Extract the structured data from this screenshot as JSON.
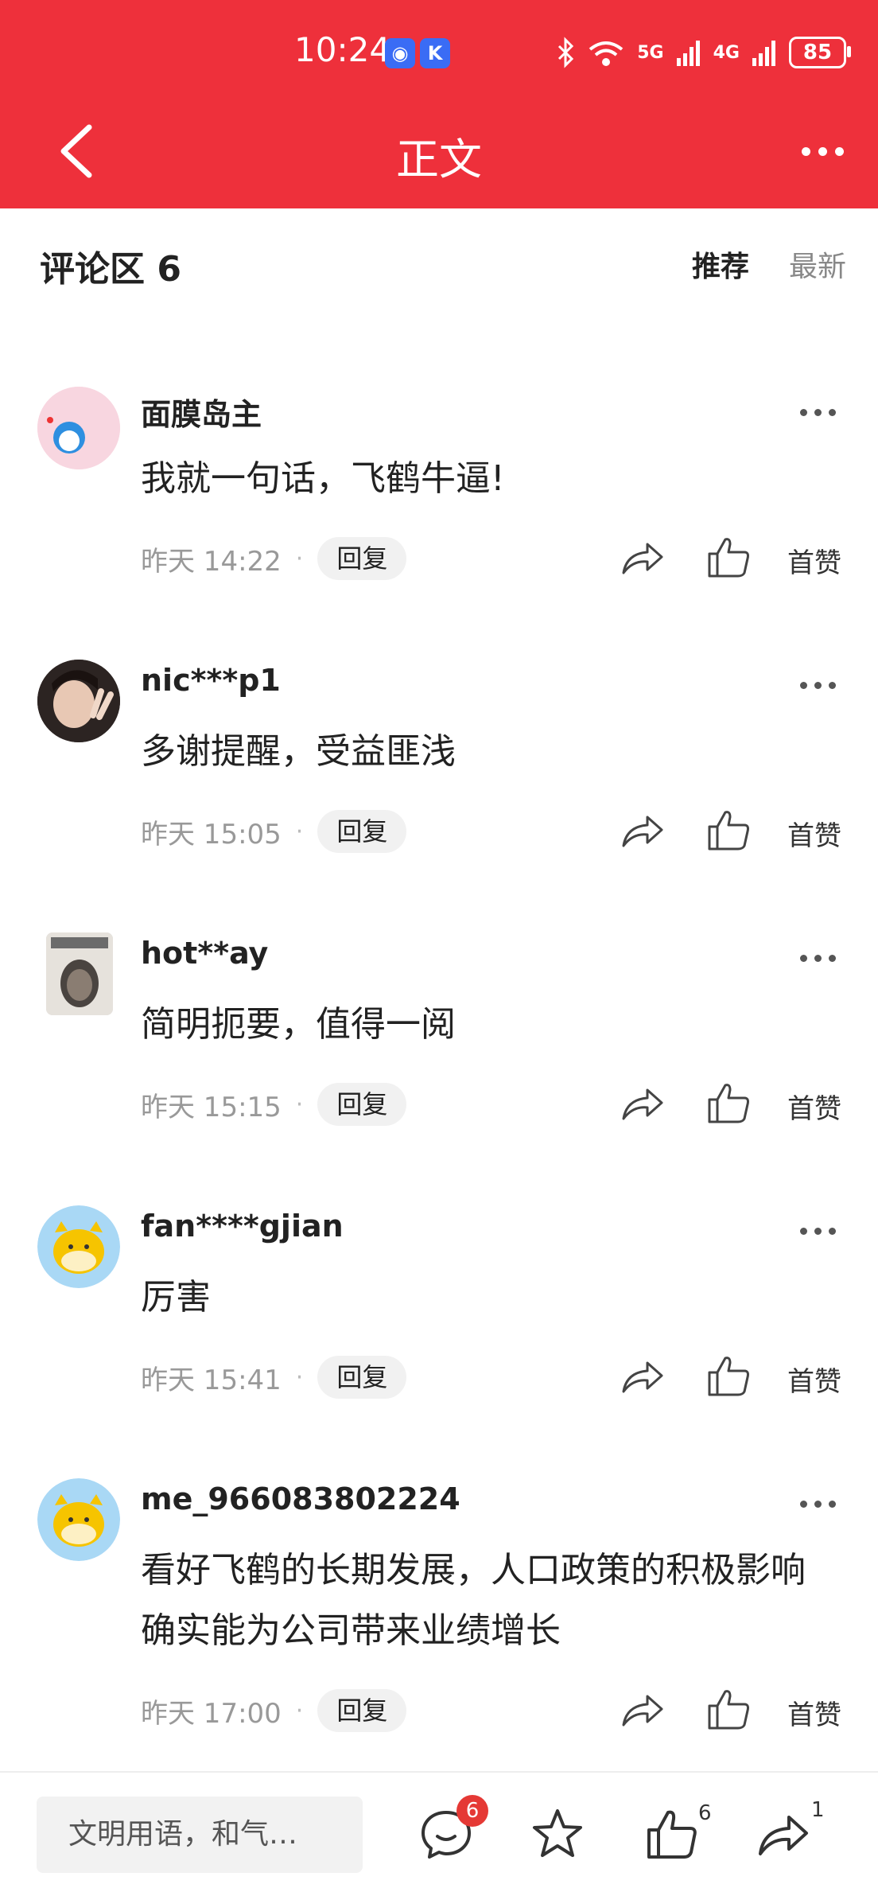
{
  "status_bar": {
    "time": "10:24",
    "battery": "85",
    "net1": "5G",
    "net2": "4G"
  },
  "header": {
    "title": "正文"
  },
  "comments_header": {
    "title": "评论区 6",
    "sort_recommended": "推荐",
    "sort_latest": "最新"
  },
  "reply_label": "回复",
  "like_label": "首赞",
  "comments": [
    {
      "user": "面膜岛主",
      "text": "我就一句话，飞鹤牛逼!",
      "time": "昨天 14:22"
    },
    {
      "user": "nic***p1",
      "text": "多谢提醒，受益匪浅",
      "time": "昨天 15:05"
    },
    {
      "user": "hot**ay",
      "text": "简明扼要，值得一阅",
      "time": "昨天 15:15"
    },
    {
      "user": "fan****gjian",
      "text": "厉害",
      "time": "昨天 15:41"
    },
    {
      "user": "me_966083802224",
      "text": "看好飞鹤的长期发展，人口政策的积极影响确实能为公司带来业绩增长",
      "time": "昨天 17:00"
    }
  ],
  "bottom_bar": {
    "input_placeholder": "文明用语，和气…",
    "comment_badge": "6",
    "like_count": "6",
    "share_count": "1"
  },
  "colors": {
    "brand_red": "#ee303b",
    "badge_red": "#e53935"
  }
}
